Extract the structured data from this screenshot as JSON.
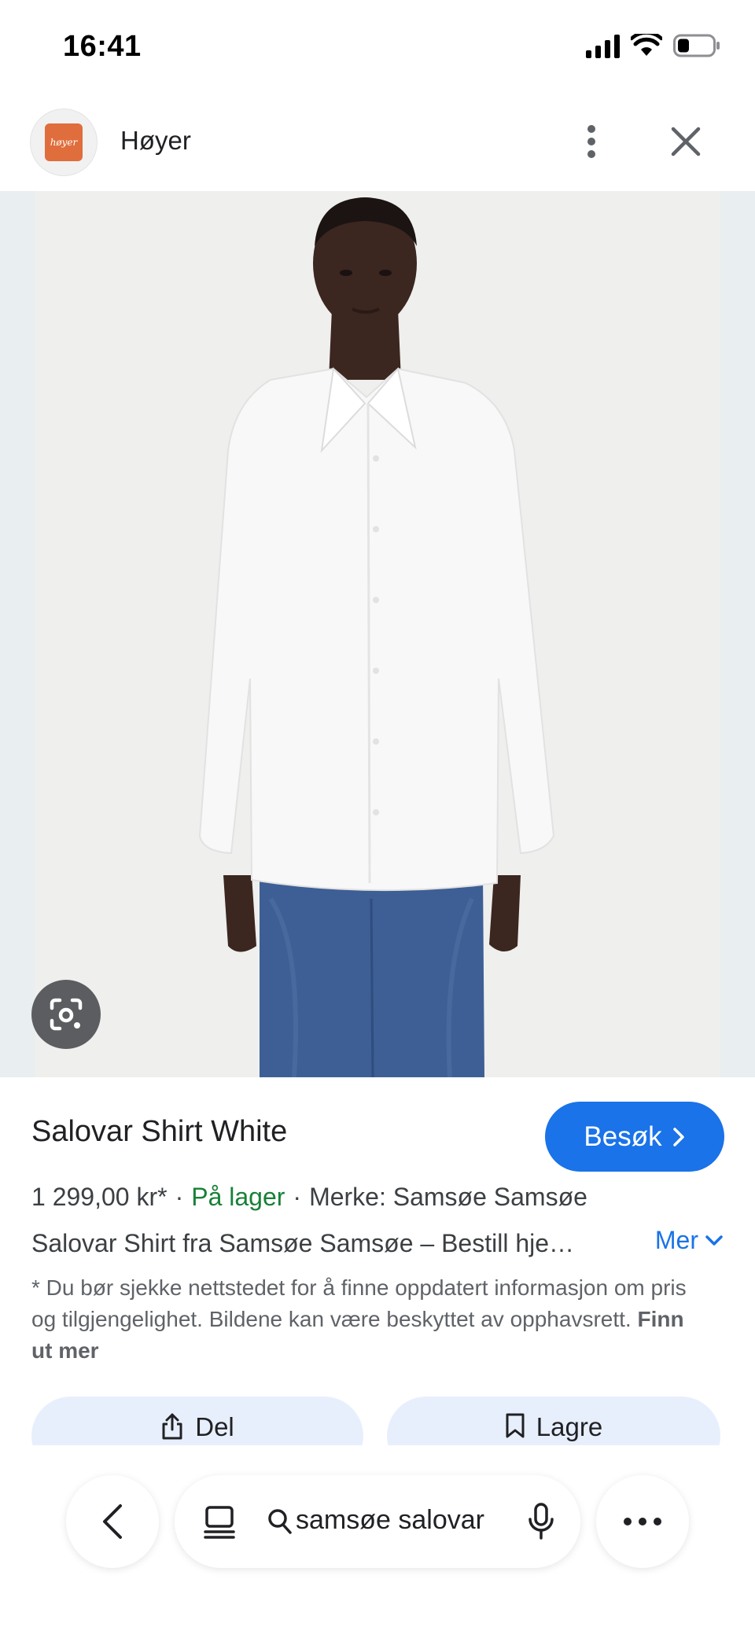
{
  "status_bar": {
    "time": "16:41"
  },
  "header": {
    "logo_text": "høyer",
    "site_name": "Høyer",
    "menu_icon": "more-vert-icon",
    "close_icon": "close-icon"
  },
  "image": {
    "lens_icon": "google-lens-icon",
    "description_of_content": ""
  },
  "product": {
    "title": "Salovar Shirt White",
    "visit_label": "Besøk",
    "price": "1 299,00 kr*",
    "dot": "·",
    "availability": "På lager",
    "brand": "Merke: Samsøe Samsøe",
    "description": "Salovar Shirt fra Samsøe Samsøe – Bestill hje…",
    "more_label": "Mer",
    "disclaimer": "* Du bør sjekke nettstedet for å finne oppdatert informasjon om pris og tilgjengelighet. Bildene kan være beskyttet av opphavsrett.",
    "learn_more": "Finn ut mer"
  },
  "actions": {
    "share_label": "Del",
    "save_label": "Lagre"
  },
  "bottom_bar": {
    "search_query": "samsøe salovar"
  },
  "colors": {
    "accent": "#1a73e8",
    "in_stock": "#188038",
    "brand_orange": "#e06d3c"
  }
}
